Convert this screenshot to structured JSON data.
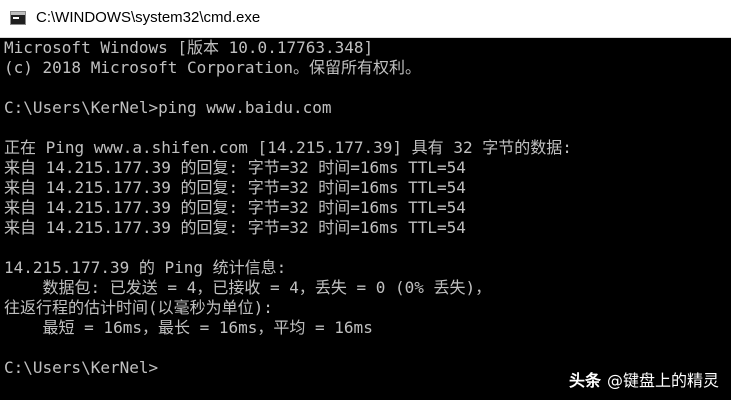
{
  "window": {
    "title": "C:\\WINDOWS\\system32\\cmd.exe",
    "icon": "cmd-console-icon"
  },
  "console": {
    "lines": [
      "Microsoft Windows [版本 10.0.17763.348]",
      "(c) 2018 Microsoft Corporation。保留所有权利。",
      "C:\\Users\\KerNel>ping www.baidu.com",
      "正在 Ping www.a.shifen.com [14.215.177.39] 具有 32 字节的数据:",
      "来自 14.215.177.39 的回复: 字节=32 时间=16ms TTL=54",
      "来自 14.215.177.39 的回复: 字节=32 时间=16ms TTL=54",
      "来自 14.215.177.39 的回复: 字节=32 时间=16ms TTL=54",
      "来自 14.215.177.39 的回复: 字节=32 时间=16ms TTL=54",
      "14.215.177.39 的 Ping 统计信息:",
      "    数据包: 已发送 = 4，已接收 = 4，丢失 = 0 (0% 丢失)，",
      "往返行程的估计时间(以毫秒为单位):",
      "    最短 = 16ms，最长 = 16ms，平均 = 16ms",
      "C:\\Users\\KerNel>"
    ]
  },
  "watermark": {
    "brand": "头条",
    "handle": "@键盘上的精灵"
  },
  "colors": {
    "console_bg": "#000000",
    "console_text": "#c0c0c0",
    "titlebar_bg": "#ffffff"
  }
}
